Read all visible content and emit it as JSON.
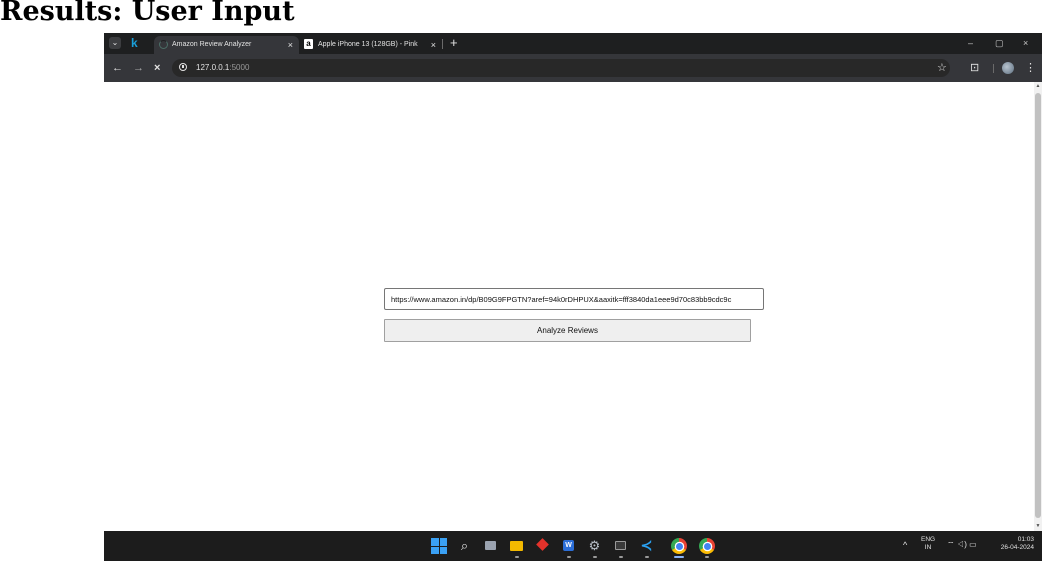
{
  "slide": {
    "title": "Results: User Input"
  },
  "browser": {
    "tabs": [
      {
        "title": "Amazon Review Analyzer",
        "close": "×",
        "active": true
      },
      {
        "title": "Apple iPhone 13 (128GB) - Pink",
        "close": "×",
        "active": false
      }
    ],
    "new_tab_label": "+",
    "profile_badge": "k",
    "favicon_letter": "a",
    "tab_menu_glyph": "⌄",
    "window_controls": {
      "minimize": "–",
      "restore": "▢",
      "close": "×"
    },
    "nav": {
      "back": "←",
      "forward": "→",
      "stop": "×"
    },
    "address": {
      "host": "127.0.0.1",
      "port": ":5000"
    },
    "toolbar_icons": {
      "bookmark": "☆",
      "extensions": "⊡",
      "menu": "⋮"
    }
  },
  "page": {
    "url_input_value": "https://www.amazon.in/dp/B09G9FPGTN?aref=94k0rDHPUX&aaxitk=fff3840da1eee9d70c83bb9cdc9c",
    "analyze_button_label": "Analyze Reviews"
  },
  "taskbar": {
    "search_glyph": "⌕",
    "settings_glyph": "⚙",
    "vscode_glyph": "≺",
    "word_letter": "W",
    "tray_chevron": "^",
    "tray_icons": "⌔ ◁) ▭",
    "language": "ENG",
    "region": "IN",
    "time": "01:03",
    "date": "26-04-2024"
  },
  "colors": {
    "tab_strip": "#1e1f20",
    "toolbar": "#35363a",
    "taskbar": "#1c1c1c",
    "accent": "#8ab4f8"
  }
}
